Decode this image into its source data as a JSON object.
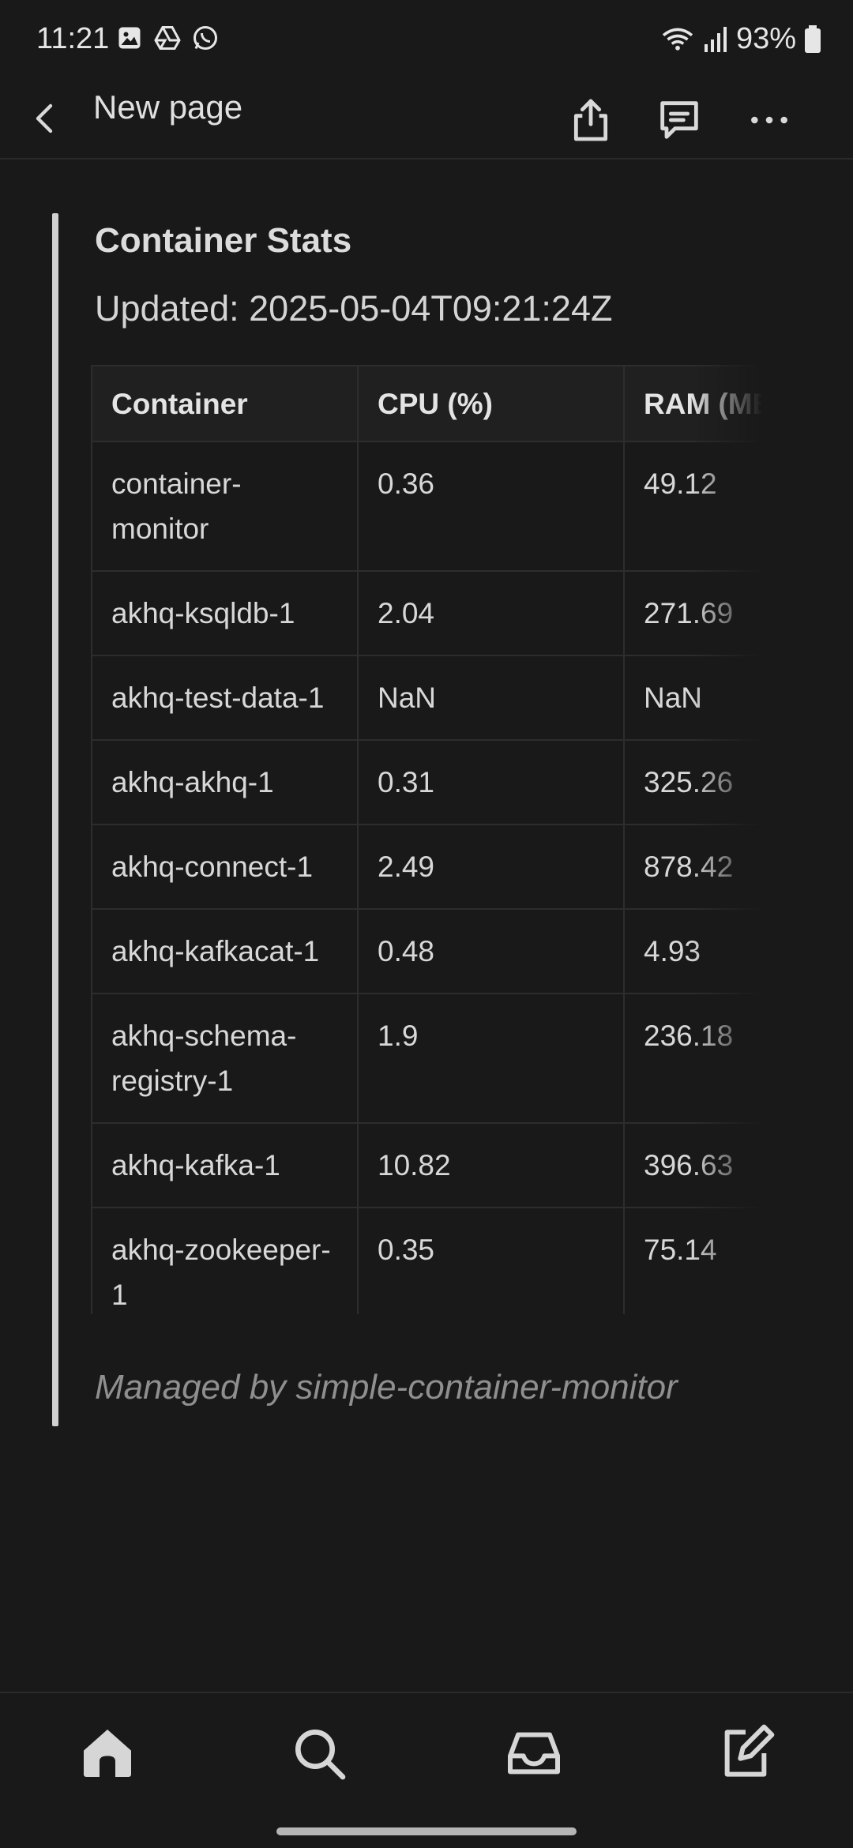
{
  "status_bar": {
    "time": "11:21",
    "left_icons": [
      "gallery-icon",
      "drive-icon",
      "whatsapp-icon"
    ],
    "right_icons": [
      "wifi-icon",
      "signal-icon",
      "battery-icon"
    ],
    "battery": "93%"
  },
  "app_bar": {
    "title": "New page",
    "actions": [
      "share-icon",
      "comment-icon",
      "more-icon"
    ]
  },
  "callout": {
    "title": "Container Stats",
    "updated": "Updated: 2025-05-04T09:21:24Z",
    "footer": "Managed by simple-container-monitor"
  },
  "table": {
    "headers": [
      "Container",
      "CPU (%)",
      "RAM (MB)"
    ],
    "rows": [
      [
        "container-monitor",
        "0.36",
        "49.12"
      ],
      [
        "akhq-ksqldb-1",
        "2.04",
        "271.69"
      ],
      [
        "akhq-test-data-1",
        "NaN",
        "NaN"
      ],
      [
        "akhq-akhq-1",
        "0.31",
        "325.26"
      ],
      [
        "akhq-connect-1",
        "2.49",
        "878.42"
      ],
      [
        "akhq-kafkacat-1",
        "0.48",
        "4.93"
      ],
      [
        "akhq-schema-registry-1",
        "1.9",
        "236.18"
      ],
      [
        "akhq-kafka-1",
        "10.82",
        "396.63"
      ],
      [
        "akhq-zookeeper-1",
        "0.35",
        "75.14"
      ]
    ]
  },
  "bottom_nav": [
    "home-icon",
    "search-icon",
    "inbox-icon",
    "compose-icon"
  ],
  "colors": {
    "background": "#191919",
    "text": "#d6d6d6",
    "muted": "#8f8f8f",
    "border": "#2d2d2d"
  }
}
